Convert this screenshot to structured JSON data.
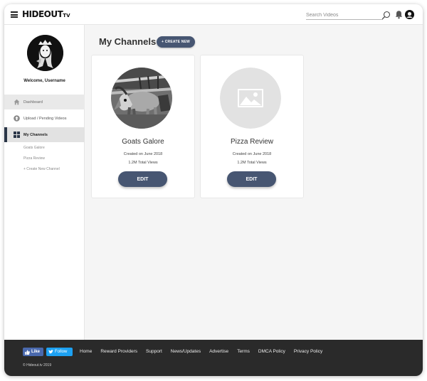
{
  "header": {
    "logo": "HIDEOUT",
    "logo_suffix": "TV",
    "search_placeholder": "Search Videos"
  },
  "sidebar": {
    "welcome": "Welcome, Username",
    "nav": [
      {
        "label": "Dashboard",
        "icon": "home-icon"
      },
      {
        "label": "Upload / Pending Videos",
        "icon": "upload-icon"
      },
      {
        "label": "My Channels",
        "icon": "grid-icon",
        "active": true
      }
    ],
    "sub_items": [
      "Goats Galore",
      "Pizza Review",
      "+ Create New Channel"
    ]
  },
  "main": {
    "title": "My Channels",
    "create_label": "+ CREATE NEW",
    "channels": [
      {
        "name": "Goats Galore",
        "created": "Created on June 2018",
        "views": "1.2M Total Views",
        "edit": "EDIT",
        "thumb": "goat-photo"
      },
      {
        "name": "Pizza Review",
        "created": "Created on June 2018",
        "views": "1.2M Total Views",
        "edit": "EDIT",
        "thumb": "image-placeholder-icon"
      }
    ]
  },
  "footer": {
    "like_label": "Like",
    "follow_label": "Follow",
    "links": [
      "Home",
      "Reward Providers",
      "Support",
      "News/Updates",
      "Advertise",
      "Terms",
      "DMCA Policy",
      "Privacy Policy"
    ],
    "copyright": "© Hideout.tv 2019"
  },
  "colors": {
    "accent": "#475672",
    "sidebar_active": "#2b3648",
    "footer_bg": "#2a2a2a",
    "facebook": "#4a69ad",
    "twitter": "#1da1f2"
  }
}
